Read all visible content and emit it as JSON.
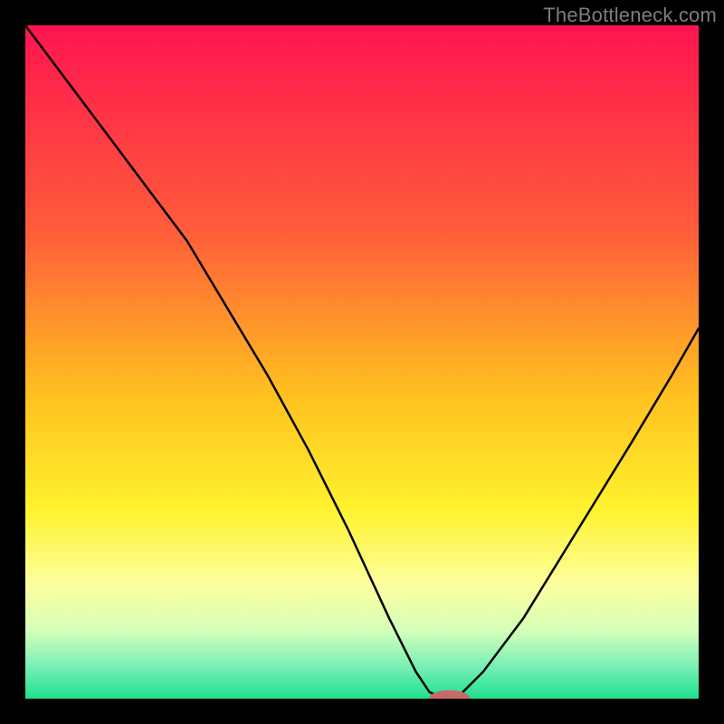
{
  "watermark": "TheBottleneck.com",
  "chart_data": {
    "type": "line",
    "title": "",
    "xlabel": "",
    "ylabel": "",
    "xlim": [
      0,
      100
    ],
    "ylim": [
      0,
      100
    ],
    "grid": false,
    "legend": null,
    "background_gradient": {
      "stops": [
        {
          "offset": 0.0,
          "color": "#ff1450"
        },
        {
          "offset": 0.3,
          "color": "#ff5b3a"
        },
        {
          "offset": 0.55,
          "color": "#ffc11f"
        },
        {
          "offset": 0.72,
          "color": "#fff22e"
        },
        {
          "offset": 0.83,
          "color": "#fdff9e"
        },
        {
          "offset": 0.9,
          "color": "#d3ffb9"
        },
        {
          "offset": 0.95,
          "color": "#7cf0b6"
        },
        {
          "offset": 1.0,
          "color": "#1ee08f"
        }
      ]
    },
    "series": [
      {
        "name": "bottleneck-curve",
        "x": [
          0,
          6,
          12,
          18,
          24,
          30,
          36,
          42,
          48,
          54,
          58,
          60,
          62,
          64,
          68,
          74,
          82,
          90,
          96,
          100
        ],
        "y": [
          100,
          92,
          84,
          76,
          68,
          58,
          48,
          37,
          25,
          12,
          4,
          1,
          0,
          0,
          4,
          12,
          25,
          38,
          48,
          55
        ]
      }
    ],
    "marker": {
      "name": "optimal-point",
      "cx": 63,
      "cy": 0,
      "rx": 3.0,
      "ry": 1.2,
      "color": "#c96a6a"
    }
  }
}
